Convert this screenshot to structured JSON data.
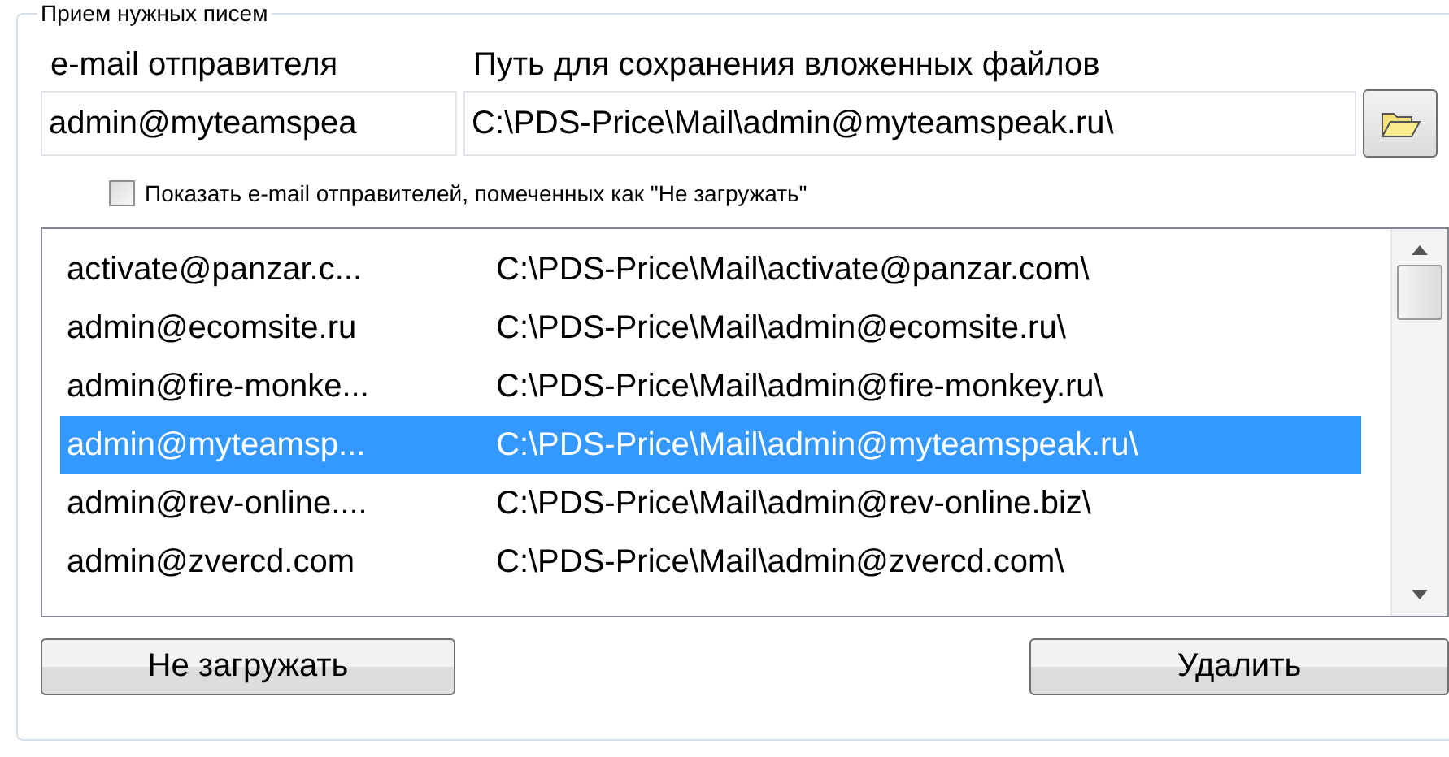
{
  "group": {
    "title": "Прием нужных писем"
  },
  "columns": [
    "e-mail отправителя",
    "Путь для сохранения вложенных файлов"
  ],
  "fields": {
    "email": "admin@myteamspea",
    "path": "C:\\PDS-Price\\Mail\\admin@myteamspeak.ru\\"
  },
  "show_hidden": {
    "label": "Показать e-mail отправителей, помеченных как \"Не загружать\"",
    "checked": false
  },
  "rows": [
    {
      "email": "activate@panzar.c...",
      "path": "C:\\PDS-Price\\Mail\\activate@panzar.com\\",
      "selected": false
    },
    {
      "email": "admin@ecomsite.ru",
      "path": "C:\\PDS-Price\\Mail\\admin@ecomsite.ru\\",
      "selected": false
    },
    {
      "email": "admin@fire-monke...",
      "path": "C:\\PDS-Price\\Mail\\admin@fire-monkey.ru\\",
      "selected": false
    },
    {
      "email": "admin@myteamsp...",
      "path": "C:\\PDS-Price\\Mail\\admin@myteamspeak.ru\\",
      "selected": true
    },
    {
      "email": "admin@rev-online....",
      "path": "C:\\PDS-Price\\Mail\\admin@rev-online.biz\\",
      "selected": false
    },
    {
      "email": "admin@zvercd.com",
      "path": "C:\\PDS-Price\\Mail\\admin@zvercd.com\\",
      "selected": false
    }
  ],
  "buttons": [
    "Не загружать",
    "Удалить"
  ]
}
